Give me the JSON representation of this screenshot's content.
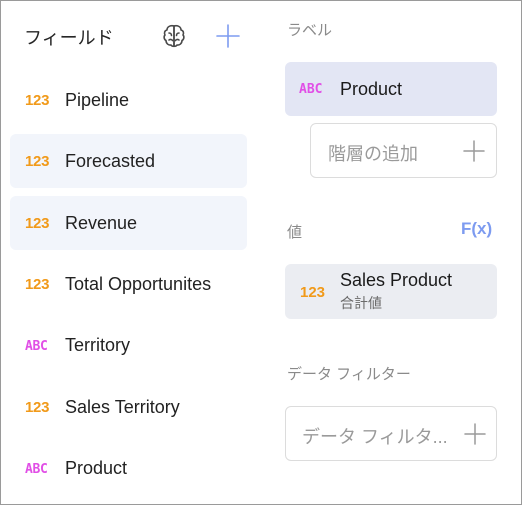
{
  "fields_panel": {
    "title": "フィールド",
    "items": [
      {
        "type": "123",
        "label": "Pipeline"
      },
      {
        "type": "123",
        "label": "Forecasted"
      },
      {
        "type": "123",
        "label": "Revenue"
      },
      {
        "type": "123",
        "label": "Total Opportunites"
      },
      {
        "type": "ABC",
        "label": "Territory"
      },
      {
        "type": "123",
        "label": "Sales Territory"
      },
      {
        "type": "ABC",
        "label": "Product"
      }
    ]
  },
  "config_panel": {
    "label_section": "ラベル",
    "label_pill": {
      "type": "ABC",
      "label": "Product"
    },
    "add_hierarchy_placeholder": "階層の追加",
    "values_section": "値",
    "fx_label": "F(x)",
    "value_pill": {
      "type": "123",
      "label": "Sales Product",
      "sub": "合計値"
    },
    "data_filter_section": "データ フィルター",
    "data_filter_placeholder": "データ フィルタ..."
  },
  "colors": {
    "numeric_badge": "#f19a1a",
    "text_badge": "#e14fe6",
    "accent": "#7d9bf0",
    "selected_bg": "#f2f5fb"
  }
}
